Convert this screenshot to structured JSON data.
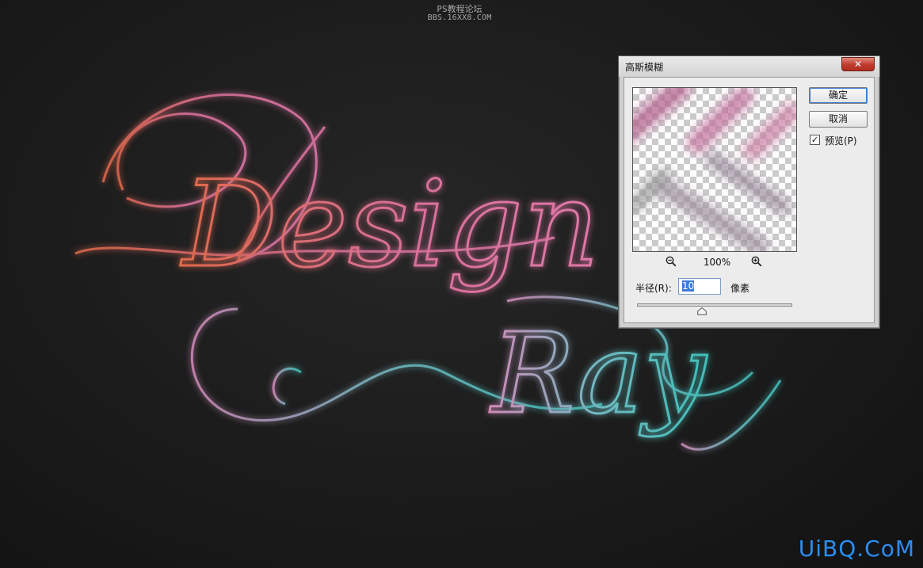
{
  "watermark": {
    "top_line1": "PS教程论坛",
    "top_line2": "BBS.16XX8.COM",
    "bottom": "UiBQ.CoM"
  },
  "artwork": {
    "text_line1": "Design",
    "text_line2": "Ray",
    "colors": {
      "line1_start": "#e0694a",
      "line1_end": "#e078a8",
      "line2_start": "#d08ab8",
      "line2_end": "#3fbfb8"
    }
  },
  "dialog": {
    "title": "高斯模糊",
    "close_icon": "close-x-icon",
    "ok_label": "确定",
    "cancel_label": "取消",
    "preview_label": "预览(P)",
    "preview_checked": true,
    "zoom_level": "100%",
    "zoom_out_icon": "zoom-out-icon",
    "zoom_in_icon": "zoom-in-icon",
    "radius_label": "半径(R):",
    "radius_value": "10",
    "radius_unit": "像素",
    "slider_fraction": 0.42
  }
}
